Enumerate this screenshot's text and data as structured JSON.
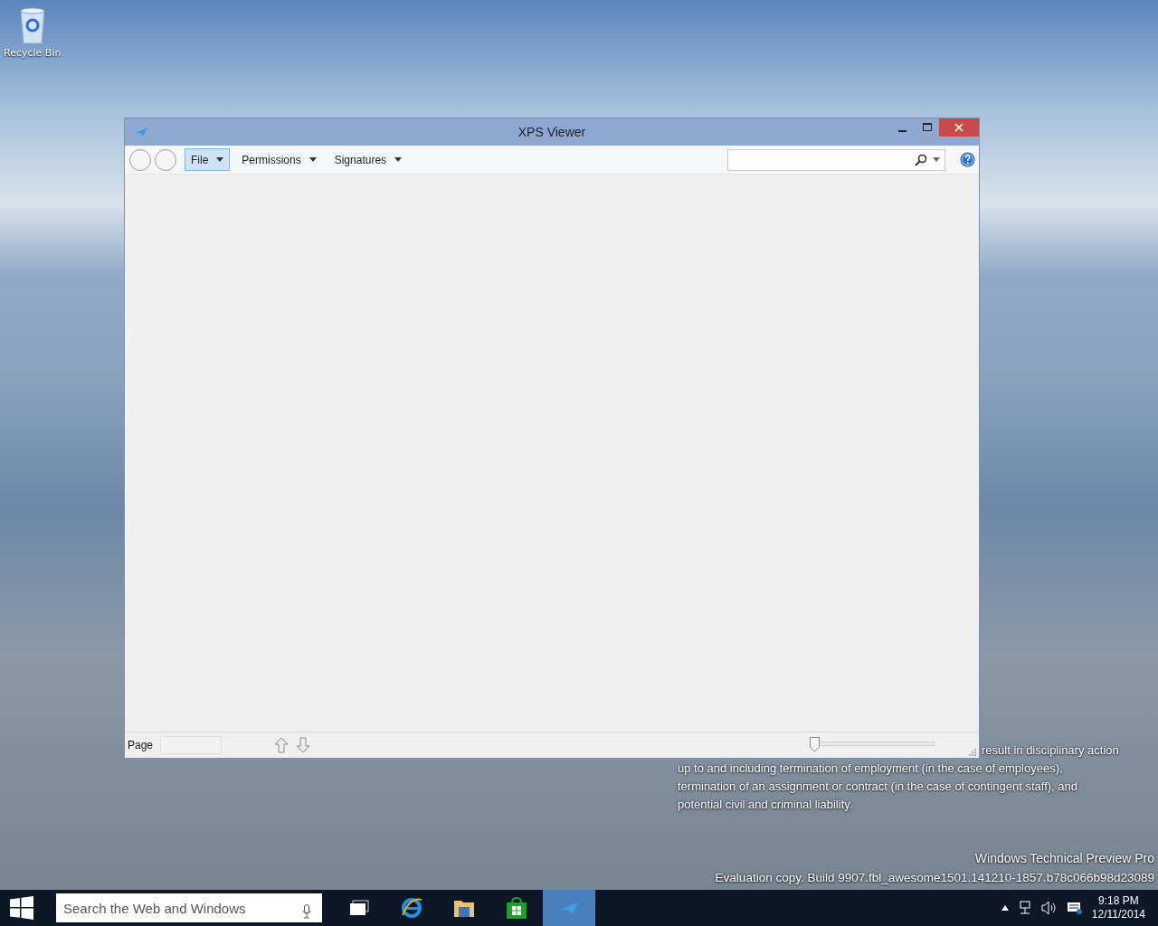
{
  "desktop": {
    "icons": [
      {
        "label": "Recycle Bin"
      }
    ],
    "notice_lines": [
      "result in disciplinary action",
      "up to and including termination of employment (in the case of employees),",
      "termination of an assignment or contract (in the case of contingent staff), and",
      "potential civil and criminal liability."
    ],
    "edition": "Windows Technical Preview Pro",
    "build": "Evaluation copy. Build 9907.fbl_awesome1501.141210-1857.b78c066b98d23089"
  },
  "window": {
    "title": "XPS Viewer",
    "menus": [
      {
        "label": "File",
        "selected": true
      },
      {
        "label": "Permissions",
        "selected": false
      },
      {
        "label": "Signatures",
        "selected": false
      }
    ],
    "status_bar": {
      "page_label": "Page",
      "zoom": {
        "level": 0
      }
    }
  },
  "taskbar": {
    "search": {
      "placeholder": "Search the Web and Windows"
    },
    "apps": [
      {
        "kind": "taskview",
        "selected": false
      },
      {
        "kind": "browser",
        "selected": false
      },
      {
        "kind": "explorer",
        "selected": false
      },
      {
        "kind": "store",
        "selected": false
      },
      {
        "kind": "xps",
        "selected": true
      }
    ],
    "time": "9:18 PM",
    "date": "12/11/2014"
  }
}
